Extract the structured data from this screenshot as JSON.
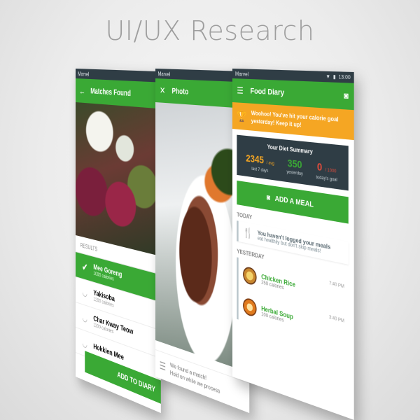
{
  "page": {
    "title": "UI/UX Research"
  },
  "screen_matches": {
    "status_label": "Marvel",
    "title": "Matches Found",
    "section": "RESULTS",
    "items": [
      {
        "name": "Mee Goreng",
        "calories": "1000 calories"
      },
      {
        "name": "Yakisoba",
        "calories": "1200 calories"
      },
      {
        "name": "Char Kway Teow",
        "calories": "1100 calories"
      },
      {
        "name": "Hokkien Mee",
        "calories": ""
      }
    ],
    "add_button": "ADD TO DIARY"
  },
  "screen_photo": {
    "status_label": "Marvel",
    "title": "Photo",
    "caption_line1": "We found a match!",
    "caption_line2": "Hold on while we process"
  },
  "screen_diary": {
    "status_label": "Marvel",
    "time": "13:00",
    "title": "Food Diary",
    "banner": "Woohoo! You've hit your calorie goal yesterday! Keep it up!",
    "summary": {
      "title": "Your Diet Summary",
      "avg_value": "2345",
      "avg_unit": "/ avg",
      "avg_label": "last 7 days",
      "yesterday_value": "350",
      "yesterday_label": "yesterday",
      "today_value": "0",
      "today_unit": "/ 1000",
      "today_label": "today's goal"
    },
    "add_meal": "ADD A MEAL",
    "today_label": "TODAY",
    "empty_title": "You haven't logged your meals",
    "empty_sub": "eat healthily but don't skip meals!",
    "yesterday_label": "YESTERDAY",
    "meals": [
      {
        "name": "Chicken Rice",
        "calories": "250 calories",
        "time": "7:40 PM"
      },
      {
        "name": "Herbal Soup",
        "calories": "100 calories",
        "time": "3:40 PM"
      }
    ]
  },
  "colors": {
    "green": "#3aa935",
    "dark": "#2f3d45",
    "orange": "#f5a623",
    "red": "#e74c3c"
  }
}
